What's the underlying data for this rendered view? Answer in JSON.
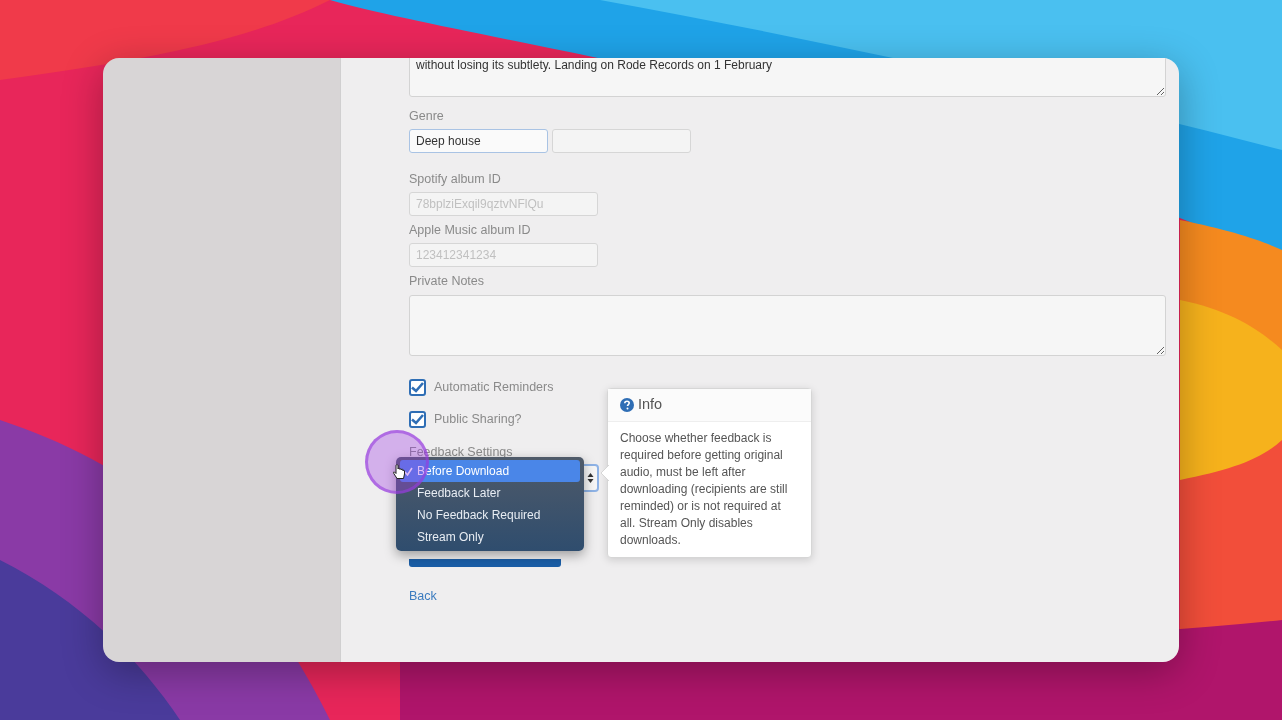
{
  "form": {
    "description": {
      "value": "without losing its subtlety. Landing on Rode Records on 1 February"
    },
    "genre": {
      "label": "Genre",
      "fields": [
        {
          "value": "Deep house",
          "focused": true
        },
        {
          "focused": false
        }
      ]
    },
    "spotify": {
      "label": "Spotify album ID",
      "placeholder": "78bplziExqil9qztvNFlQu"
    },
    "apple_music": {
      "label": "Apple Music album ID",
      "placeholder": "123412341234"
    },
    "private_notes": {
      "label": "Private Notes"
    },
    "checkboxes": [
      {
        "label": "Automatic Reminders",
        "checked": true
      },
      {
        "label": "Public Sharing?",
        "checked": true
      }
    ],
    "feedback_settings": {
      "label": "Feedback Settings",
      "options": [
        {
          "label": "Before Download",
          "selected": true
        },
        {
          "label": "Feedback Later",
          "selected": false
        },
        {
          "label": "No Feedback Required",
          "selected": false
        },
        {
          "label": "Stream Only",
          "selected": false
        }
      ]
    },
    "back_link": "Back"
  },
  "info_popover": {
    "title": "Info",
    "text": "Choose whether feedback is required before getting original audio, must be left after downloading (recipients are still reminded) or is not required at all. Stream Only disables downloads."
  }
}
